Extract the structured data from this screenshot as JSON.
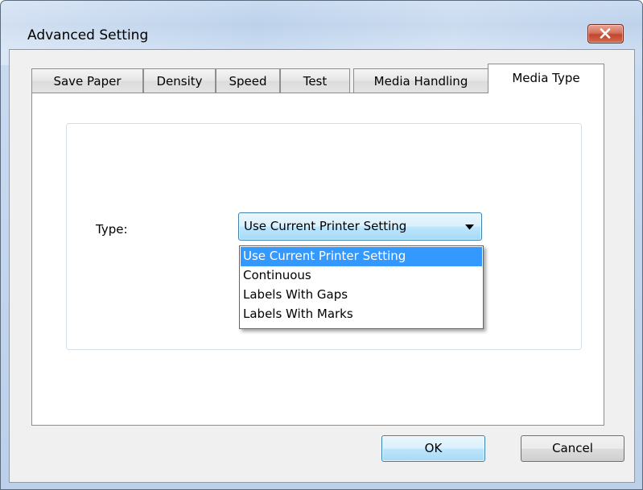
{
  "window": {
    "title": "Advanced Setting"
  },
  "tabs": [
    {
      "label": "Save Paper"
    },
    {
      "label": "Density"
    },
    {
      "label": "Speed"
    },
    {
      "label": "Test"
    },
    {
      "label": "Media Handling"
    },
    {
      "label": "Media Type"
    }
  ],
  "active_tab": "Media Type",
  "media_type": {
    "type_label": "Type:",
    "selected_value": "Use Current Printer Setting",
    "options": [
      {
        "label": "Use Current Printer Setting",
        "highlighted": true
      },
      {
        "label": "Continuous",
        "highlighted": false
      },
      {
        "label": "Labels With Gaps",
        "highlighted": false
      },
      {
        "label": "Labels With Marks",
        "highlighted": false
      }
    ]
  },
  "buttons": {
    "ok": "OK",
    "cancel": "Cancel"
  },
  "colors": {
    "highlight": "#3399ff",
    "close_button": "#c2452c"
  }
}
